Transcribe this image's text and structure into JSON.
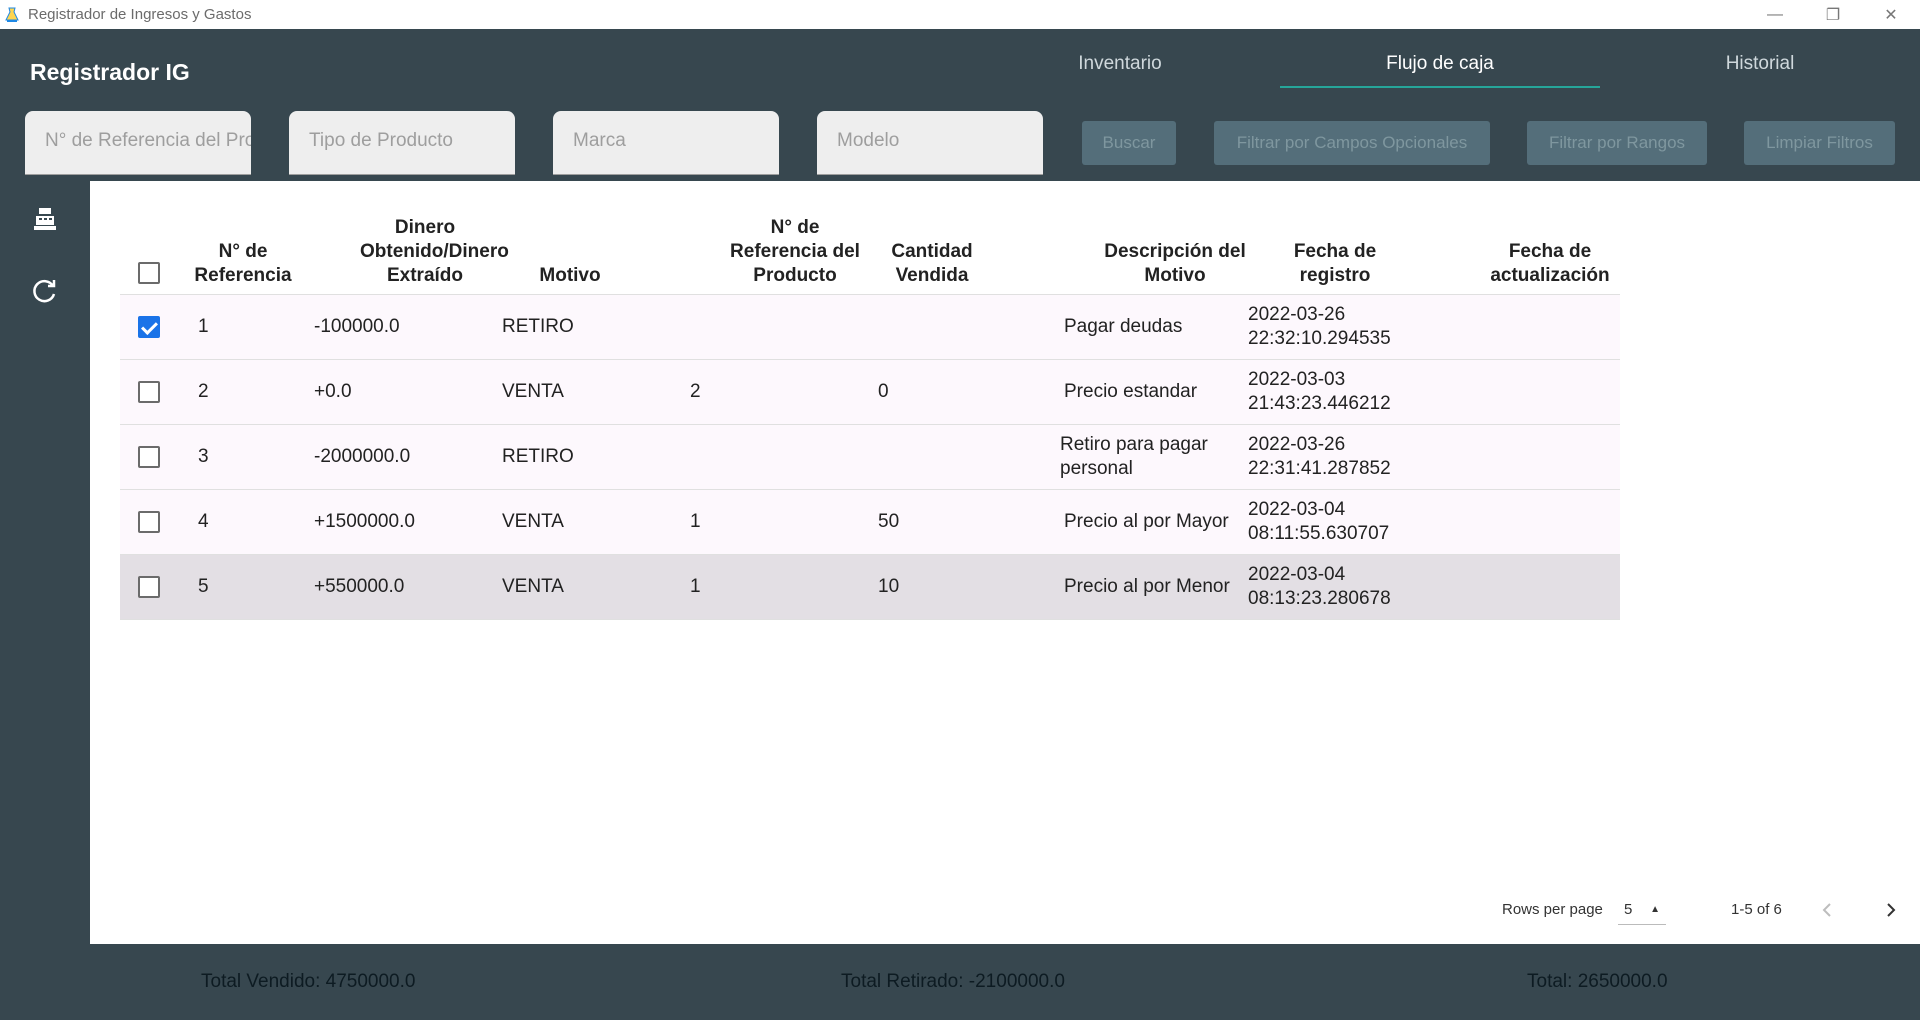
{
  "window": {
    "title": "Registrador de Ingresos y Gastos",
    "minimize": "—",
    "restore": "❐",
    "close": "✕"
  },
  "brand": "Registrador IG",
  "tabs": [
    {
      "label": "Inventario",
      "active": false
    },
    {
      "label": "Flujo de caja",
      "active": true
    },
    {
      "label": "Historial",
      "active": false
    }
  ],
  "filters": {
    "reference_placeholder": "N° de Referencia del Producto",
    "type_placeholder": "Tipo de Producto",
    "brand_placeholder": "Marca",
    "model_placeholder": "Modelo"
  },
  "actions": {
    "search": "Buscar",
    "optional_filter": "Filtrar por Campos Opcionales",
    "range_filter": "Filtrar por Rangos",
    "clear_filters": "Limpiar Filtros"
  },
  "rail": {
    "register_icon": "cash-register-icon",
    "refresh_icon": "refresh-icon"
  },
  "table": {
    "columns": {
      "ref": "N° de Referencia",
      "money": "Dinero Obtenido/Dinero Extraído",
      "reason": "Motivo",
      "product_ref": "N° de Referencia del Producto",
      "qty": "Cantidad Vendida",
      "description": "Descripción del Motivo",
      "created": "Fecha de registro",
      "updated": "Fecha de actualización"
    },
    "rows": [
      {
        "checked": true,
        "ref": "1",
        "money": "-100000.0",
        "reason": "RETIRO",
        "product_ref": "",
        "qty": "",
        "description": "Pagar deudas",
        "created": "2022-03-26 22:32:10.294535",
        "updated": ""
      },
      {
        "checked": false,
        "ref": "2",
        "money": "+0.0",
        "reason": "VENTA",
        "product_ref": "2",
        "qty": "0",
        "description": "Precio estandar",
        "created": "2022-03-03 21:43:23.446212",
        "updated": ""
      },
      {
        "checked": false,
        "ref": "3",
        "money": "-2000000.0",
        "reason": "RETIRO",
        "product_ref": "",
        "qty": "",
        "description": "Retiro para pagar personal",
        "created": "2022-03-26 22:31:41.287852",
        "updated": ""
      },
      {
        "checked": false,
        "ref": "4",
        "money": "+1500000.0",
        "reason": "VENTA",
        "product_ref": "1",
        "qty": "50",
        "description": "Precio al por Mayor",
        "created": "2022-03-04 08:11:55.630707",
        "updated": ""
      },
      {
        "checked": false,
        "ref": "5",
        "money": "+550000.0",
        "reason": "VENTA",
        "product_ref": "1",
        "qty": "10",
        "description": "Precio al por Menor",
        "created": "2022-03-04 08:13:23.280678",
        "updated": ""
      }
    ]
  },
  "pagination": {
    "rows_per_page_label": "Rows per page",
    "rows_per_page_value": "5",
    "range": "1-5 of 6"
  },
  "totals": {
    "sold": "Total Vendido: 4750000.0",
    "withdrawn": "Total Retirado: -2100000.0",
    "total": "Total: 2650000.0"
  }
}
